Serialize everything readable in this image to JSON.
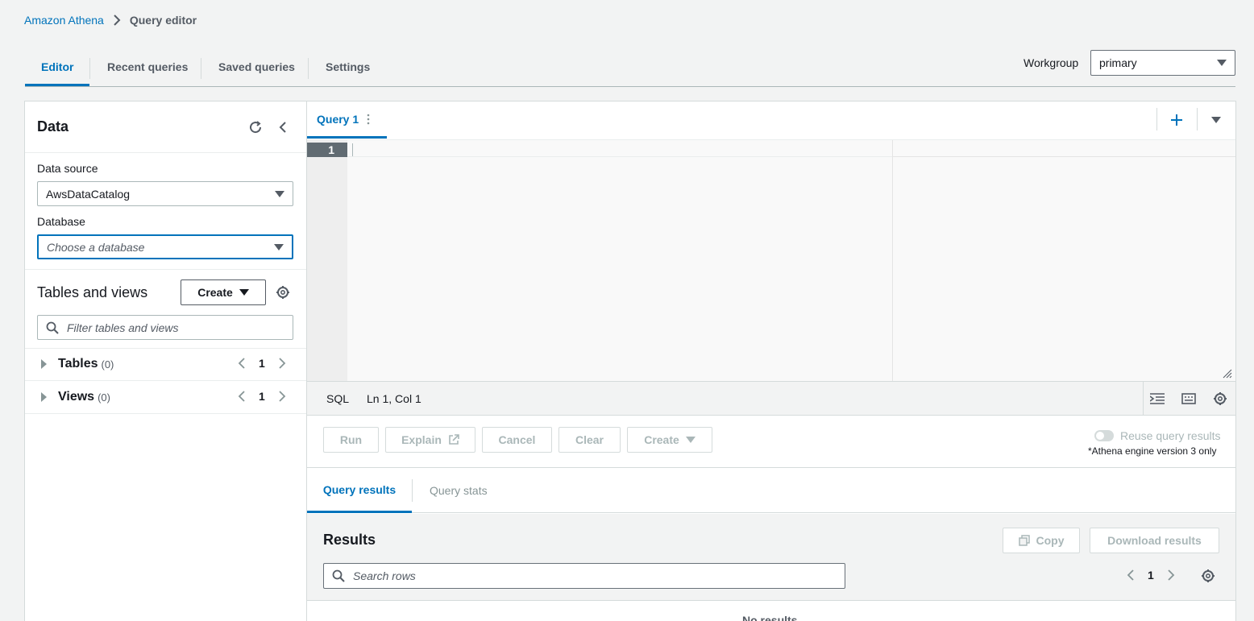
{
  "breadcrumb": {
    "root": "Amazon Athena",
    "current": "Query editor"
  },
  "tabs": [
    {
      "label": "Editor",
      "active": true
    },
    {
      "label": "Recent queries",
      "active": false
    },
    {
      "label": "Saved queries",
      "active": false
    },
    {
      "label": "Settings",
      "active": false
    }
  ],
  "workgroup": {
    "label": "Workgroup",
    "value": "primary"
  },
  "data_panel": {
    "title": "Data",
    "data_source_label": "Data source",
    "data_source_value": "AwsDataCatalog",
    "database_label": "Database",
    "database_placeholder": "Choose a database",
    "tables_views_title": "Tables and views",
    "create_label": "Create",
    "filter_placeholder": "Filter tables and views",
    "tables": {
      "label": "Tables",
      "count": "(0)",
      "page": "1"
    },
    "views": {
      "label": "Views",
      "count": "(0)",
      "page": "1"
    }
  },
  "query_tab": {
    "label": "Query 1"
  },
  "editor": {
    "line_number": "1"
  },
  "status_bar": {
    "language": "SQL",
    "position": "Ln 1, Col 1"
  },
  "actions": {
    "run": "Run",
    "explain": "Explain",
    "cancel": "Cancel",
    "clear": "Clear",
    "create": "Create",
    "reuse_label": "Reuse query results",
    "reuse_note": "*Athena engine version 3 only"
  },
  "results": {
    "tab_results": "Query results",
    "tab_stats": "Query stats",
    "title": "Results",
    "copy": "Copy",
    "download": "Download results",
    "search_placeholder": "Search rows",
    "page": "1",
    "no_results": "No results"
  },
  "colors": {
    "accent": "#0073bb",
    "background": "#f2f3f3"
  }
}
